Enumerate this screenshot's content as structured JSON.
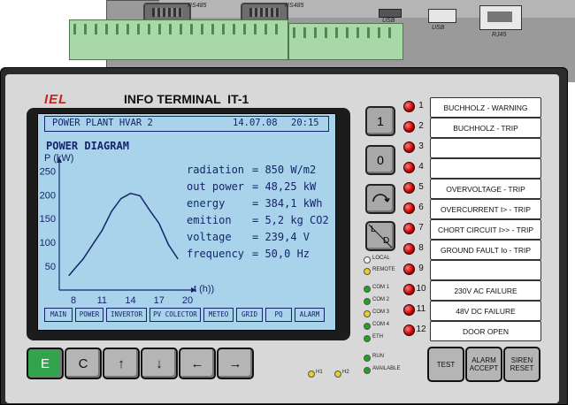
{
  "device": {
    "brand": "IEL",
    "title": "INFO TERMINAL  IT-1"
  },
  "connectors": {
    "rs485a": "RS485",
    "rs485b": "RS485",
    "usb1": "USB",
    "usb2": "USB",
    "rj45": "RJ45"
  },
  "screen": {
    "plant": "POWER PLANT HVAR 2",
    "date": "14.07.08",
    "time": "20:15",
    "heading": "POWER DIAGRAM",
    "ylabel": "P (kW)",
    "xlabel": "t (h))",
    "readings": [
      {
        "label": "radiation",
        "value": "= 850 W/m2"
      },
      {
        "label": "out power",
        "value": "= 48,25 kW"
      },
      {
        "label": "energy",
        "value": "= 384,1 kWh"
      },
      {
        "label": "emition",
        "value": "= 5,2 kg CO2"
      },
      {
        "label": "voltage",
        "value": "= 239,4 V"
      },
      {
        "label": "frequency",
        "value": "= 50,0 Hz"
      }
    ],
    "tabs": [
      "MAIN",
      "POWER",
      "INVERTOR",
      "PV COLECTOR",
      "METEO",
      "GRID",
      "PQ",
      "ALARM"
    ]
  },
  "chart_data": {
    "type": "line",
    "ylabel": "P (kW)",
    "xlabel": "t (h))",
    "x_ticks": [
      "8",
      "11",
      "14",
      "17",
      "20"
    ],
    "y_ticks": [
      "50",
      "100",
      "150",
      "200",
      "250"
    ],
    "x": [
      7.5,
      8,
      9,
      10,
      11,
      12,
      13,
      14,
      15,
      16,
      17,
      18,
      19
    ],
    "values": [
      30,
      42,
      65,
      95,
      125,
      165,
      192,
      203,
      198,
      168,
      140,
      95,
      65
    ],
    "xlim": [
      6.5,
      20
    ],
    "ylim": [
      0,
      260
    ]
  },
  "keys": {
    "one": "1",
    "zero": "0",
    "ld_l": "L",
    "ld_d": "D"
  },
  "status": {
    "local": "LOCAL",
    "remote": "REMOTE",
    "com1": "COM 1",
    "com2": "COM 2",
    "com3": "COM 3",
    "com4": "COM 4",
    "eth": "ETH",
    "run": "RUN",
    "available": "AVAILABLE",
    "h1": "H1",
    "h2": "H2",
    "colors": {
      "green": "#1fa31f",
      "yellow": "#e8d020",
      "white": "#f2f2f2"
    }
  },
  "alarms": [
    {
      "num": "1",
      "label": "BUCHHOLZ - WARNING"
    },
    {
      "num": "2",
      "label": "BUCHHOLZ - TRIP"
    },
    {
      "num": "3",
      "label": ""
    },
    {
      "num": "4",
      "label": ""
    },
    {
      "num": "5",
      "label": "OVERVOLTAGE - TRIP"
    },
    {
      "num": "6",
      "label": "OVERCURRENT I> - TRIP"
    },
    {
      "num": "7",
      "label": "CHORT CIRCUIT I>> - TRIP"
    },
    {
      "num": "8",
      "label": "GROUND FAULT Io - TRIP"
    },
    {
      "num": "9",
      "label": ""
    },
    {
      "num": "10",
      "label": "230V AC FAILURE"
    },
    {
      "num": "11",
      "label": "48V DC FAILURE"
    },
    {
      "num": "12",
      "label": "DOOR OPEN"
    }
  ],
  "bottom_keys": {
    "e": "E",
    "c": "C",
    "up": "↑",
    "down": "↓",
    "left": "←",
    "right": "→",
    "test": "TEST",
    "alarm_accept": "ALARM ACCEPT",
    "siren_reset": "SIREN RESET"
  }
}
